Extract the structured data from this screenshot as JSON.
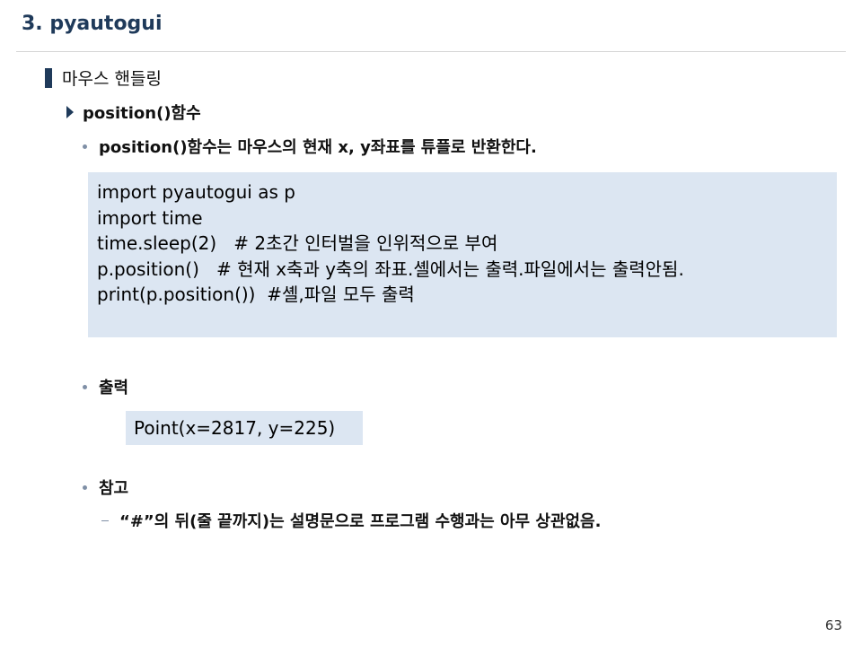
{
  "slide": {
    "title": "3. pyautogui",
    "section": "마우스 핸들링",
    "subheading": "position()함수",
    "bullets": {
      "description": "position()함수는 마우스의 현재 x, y좌표를 튜플로 반환한다.",
      "output_label": "출력",
      "note_label": "참고"
    },
    "code_lines": [
      "import pyautogui as p",
      "import time",
      "time.sleep(2)   # 2초간 인터벌을 인위적으로 부여",
      "p.position()   # 현재 x축과 y축의 좌표.셸에서는 출력.파일에서는 출력안됨.",
      "print(p.position())  #셸,파일 모두 출력"
    ],
    "output_text": "Point(x=2817, y=225)",
    "note_detail": "“#”의 뒤(줄 끝까지)는 설명문으로 프로그램 수행과는 아무 상관없음.",
    "page_number": "63"
  },
  "colors": {
    "title": "#1F3A5A",
    "code_background": "#DCE6F2",
    "bullet_marker": "#7f8fa6"
  }
}
